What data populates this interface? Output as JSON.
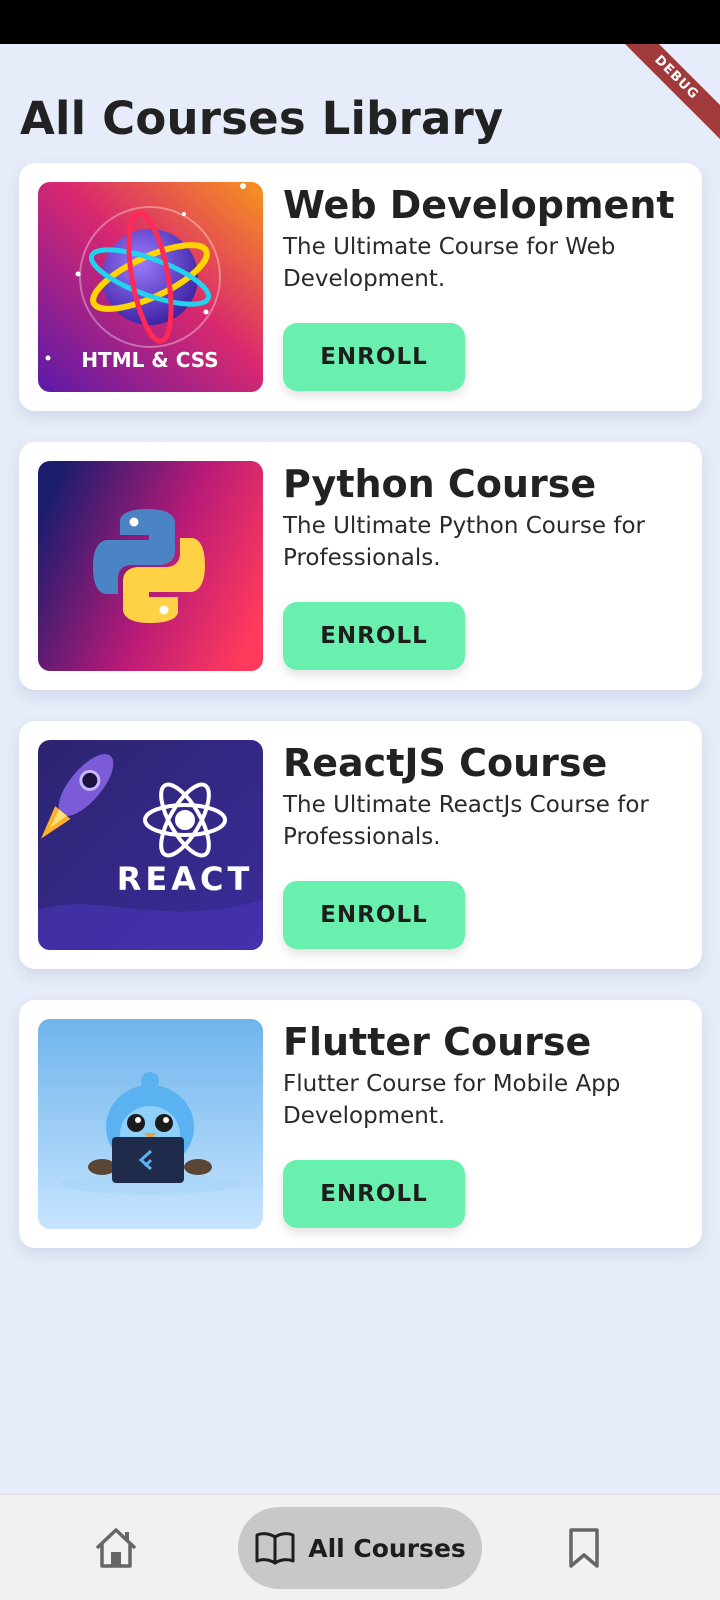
{
  "debug_banner": "DEBUG",
  "page_title": "All Courses Library",
  "courses": [
    {
      "title": "Web Development",
      "description": "The Ultimate Course for Web Development.",
      "button_label": "ENROLL",
      "thumbnail_text": "HTML & CSS"
    },
    {
      "title": "Python Course",
      "description": "The Ultimate Python Course for Professionals.",
      "button_label": "ENROLL"
    },
    {
      "title": "ReactJS Course",
      "description": "The Ultimate ReactJs Course for Professionals.",
      "button_label": "ENROLL",
      "thumbnail_text": "REACT"
    },
    {
      "title": "Flutter Course",
      "description": "Flutter Course for Mobile App Development.",
      "button_label": "ENROLL"
    }
  ],
  "bottom_nav": {
    "items": [
      {
        "icon": "home-icon"
      },
      {
        "label": "All Courses",
        "icon": "book-icon",
        "active": true
      },
      {
        "icon": "bookmark-icon"
      }
    ]
  },
  "colors": {
    "background": "#e6ecf9",
    "enroll_button": "#69f0ae",
    "nav_active": "#c8c8c8"
  }
}
